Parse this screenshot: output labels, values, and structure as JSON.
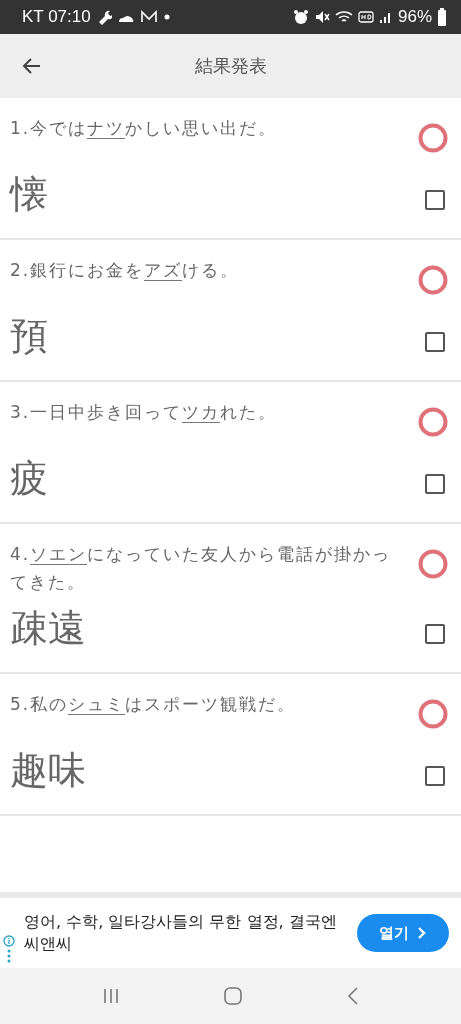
{
  "status_bar": {
    "carrier_time": "KT 07:10",
    "battery": "96%"
  },
  "app_bar": {
    "title": "結果発表"
  },
  "questions": [
    {
      "prefix": "1.今では",
      "underlined": "ナツ",
      "suffix": "かしい思い出だ。",
      "answer": "懐",
      "correct": true,
      "checked": false
    },
    {
      "prefix": "2.銀行にお金を",
      "underlined": "アズ",
      "suffix": "ける。",
      "answer": "預",
      "correct": true,
      "checked": false
    },
    {
      "prefix": "3.一日中歩き回って",
      "underlined": "ツカ",
      "suffix": "れた。",
      "answer": "疲",
      "correct": true,
      "checked": false
    },
    {
      "prefix": "4.",
      "underlined": "ソエン",
      "suffix": "になっていた友人から電話が掛かってきた。",
      "answer": "疎遠",
      "correct": true,
      "checked": false
    },
    {
      "prefix": "5.私の",
      "underlined": "シュミ",
      "suffix": "はスポーツ観戦だ。",
      "answer": "趣味",
      "correct": true,
      "checked": false
    }
  ],
  "ad": {
    "text": "영어, 수학, 일타강사들의 무한 열정, 결국엔 씨앤씨",
    "button": "열기"
  }
}
